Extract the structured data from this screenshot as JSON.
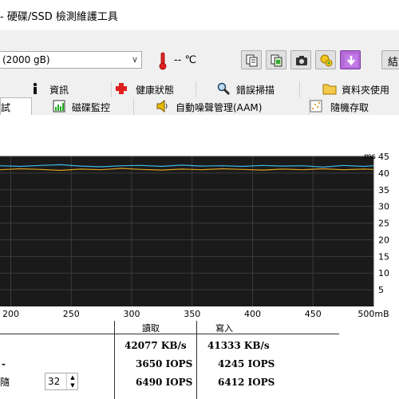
{
  "window": {
    "title": "- 硬碟/SSD 檢測維護工具"
  },
  "toolbar": {
    "drive": "(2000 gB)",
    "temperature": "-- ℃",
    "truncated_button_label": "結"
  },
  "tabs_row1": [
    {
      "label": "資訊",
      "icon": "info-icon"
    },
    {
      "label": "健康狀態",
      "icon": "health-cross-icon"
    },
    {
      "label": "錯誤掃描",
      "icon": "magnifier-icon"
    },
    {
      "label": "資料夾使用",
      "icon": "folder-icon"
    }
  ],
  "tabs_row2": [
    {
      "label": "試",
      "active": true
    },
    {
      "label": "磁碟監控",
      "icon": "disk-monitor-icon"
    },
    {
      "label": "自動噪聲管理(AAM)",
      "icon": "speaker-icon"
    },
    {
      "label": "隨機存取",
      "icon": "random-access-icon"
    }
  ],
  "chart_data": {
    "type": "line",
    "y_unit": "ms",
    "ylim": [
      0,
      45
    ],
    "y_ticks": [
      "45",
      "40",
      "35",
      "30",
      "25",
      "20",
      "15",
      "10",
      "5"
    ],
    "x_ticks": [
      "100",
      "150",
      "200",
      "250",
      "300",
      "350",
      "400",
      "450",
      "500mB"
    ],
    "xlim": [
      100,
      500
    ],
    "grid": true,
    "series": [
      {
        "color": "#3bb9e8",
        "x": [
          100,
          120,
          140,
          160,
          180,
          200,
          220,
          240,
          260,
          280,
          300,
          320,
          340,
          360,
          380,
          400,
          420,
          440,
          460,
          470
        ],
        "values": [
          42.2,
          42.0,
          42.3,
          42.5,
          42.1,
          41.9,
          42.2,
          42.3,
          42.0,
          42.4,
          42.1,
          42.2,
          42.0,
          42.3,
          42.1,
          42.2,
          41.8,
          42.3,
          42.0,
          42.2
        ]
      },
      {
        "color": "#e0a020",
        "x": [
          100,
          120,
          140,
          160,
          180,
          200,
          220,
          240,
          260,
          280,
          300,
          320,
          340,
          360,
          380,
          400,
          420,
          440,
          460,
          470
        ],
        "values": [
          41.0,
          41.3,
          41.1,
          40.8,
          41.2,
          41.0,
          41.4,
          41.1,
          40.9,
          41.2,
          41.0,
          41.3,
          41.1,
          40.9,
          41.2,
          41.0,
          41.3,
          41.0,
          41.2,
          41.1
        ]
      }
    ]
  },
  "results": {
    "headers": [
      "讀取",
      "寫入"
    ],
    "rows": [
      {
        "label": "",
        "read": "42077 KB/s",
        "write": "41333 KB/s"
      },
      {
        "label": "-",
        "read": "3650 IOPS",
        "write": "4245 IOPS"
      },
      {
        "label": "隨",
        "read": "6490 IOPS",
        "write": "6412 IOPS"
      }
    ],
    "queue_depth": "32"
  },
  "colors": {
    "chart_bg": "#1a1a1a",
    "grid": "#3a3a3a",
    "read_line": "#3bb9e8",
    "write_line": "#e0a020"
  }
}
